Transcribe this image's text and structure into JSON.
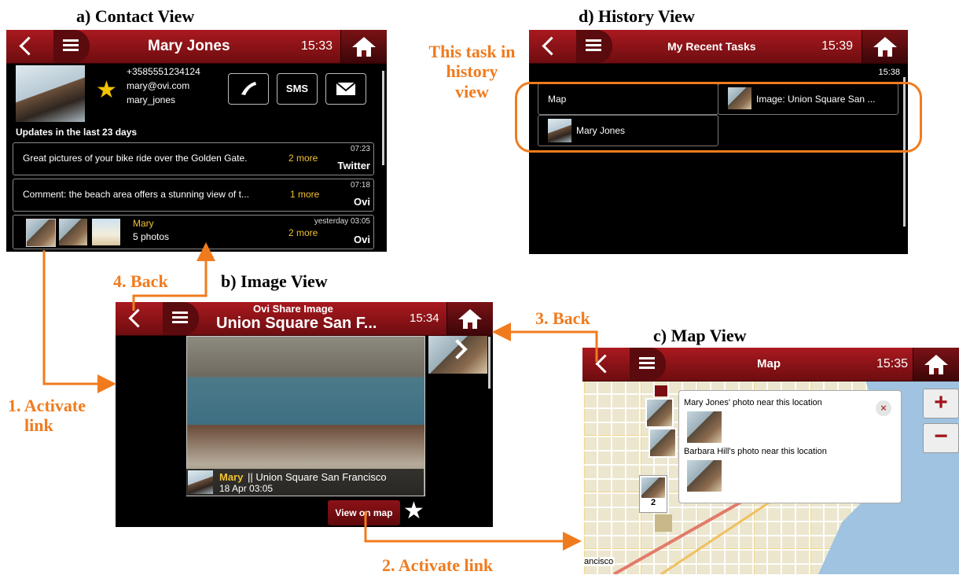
{
  "labels": {
    "contact_view": "a) Contact View",
    "image_view": "b) Image View",
    "map_view": "c) Map View",
    "history_view": "d) History View"
  },
  "annotations": {
    "activate_link_1_a": "1.  Activate",
    "activate_link_1_b": "link",
    "activate_link_2": "2. Activate link",
    "back_3": "3. Back",
    "back_4": "4. Back",
    "history_note_1": "This task in",
    "history_note_2": "history",
    "history_note_3": "view"
  },
  "colors": {
    "accent": "#f07b1e",
    "topbar": "#8c1217",
    "link": "#f2c230"
  },
  "contact": {
    "title": "Mary Jones",
    "time": "15:33",
    "phone": "+3585551234124",
    "email": "mary@ovi.com",
    "username": "mary_jones",
    "sms_label": "SMS",
    "updates_heading": "Updates in the last 23 days",
    "updates": [
      {
        "text": "Great pictures of your bike ride over the Golden Gate.",
        "more": "2 more",
        "time": "07:23",
        "source": "Twitter"
      },
      {
        "text": "Comment: the beach area offers a stunning view of t...",
        "more": "1 more",
        "time": "07:18",
        "source": "Ovi"
      }
    ],
    "photo_update": {
      "name": "Mary",
      "count": "5 photos",
      "more": "2 more",
      "time": "yesterday 03:05",
      "source": "Ovi"
    }
  },
  "history": {
    "title": "My Recent Tasks",
    "time": "15:39",
    "subtime": "15:38",
    "items": [
      "Map",
      "Image: Union Square San ...",
      "Mary Jones"
    ]
  },
  "image": {
    "title_line1": "Ovi Share Image",
    "title_line2": "Union Square San F...",
    "time": "15:34",
    "owner": "Mary",
    "caption": "|| Union Square San Francisco",
    "date": "18 Apr 03:05",
    "view_on_map": "View on map"
  },
  "map": {
    "title": "Map",
    "time": "15:35",
    "popup_1": "Mary Jones' photo near this location",
    "popup_2": "Barbara Hill's photo near this location",
    "cluster_count": "2",
    "place_label": "ancisco",
    "zoom_in": "+",
    "zoom_out": "−"
  }
}
